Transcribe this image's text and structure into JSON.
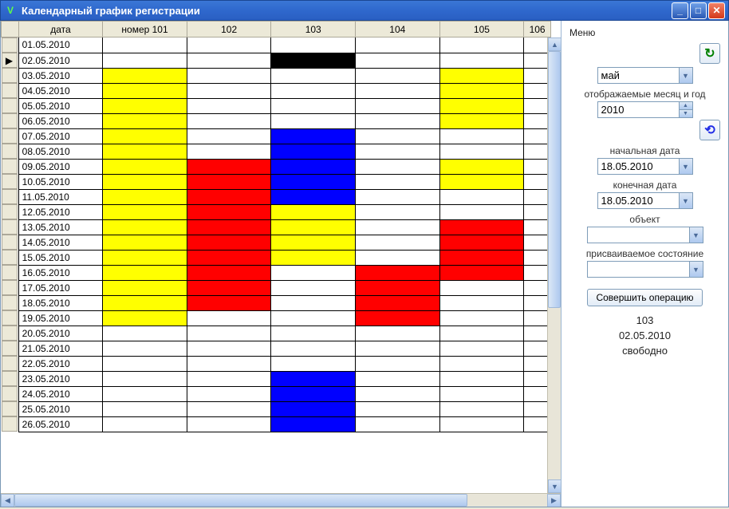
{
  "window": {
    "title": "Календарный график регистрации"
  },
  "menu_label": "Меню",
  "grid": {
    "headers": [
      "",
      "дата",
      "номер 101",
      "102",
      "103",
      "104",
      "105",
      "106"
    ],
    "selected_row_index": 1,
    "rows": [
      {
        "date": "01.05.2010",
        "cells": [
          "",
          "",
          "",
          "",
          "",
          ""
        ]
      },
      {
        "date": "02.05.2010",
        "cells": [
          "",
          "",
          "black",
          "",
          "",
          ""
        ]
      },
      {
        "date": "03.05.2010",
        "cells": [
          "yellow",
          "",
          "",
          "",
          "yellow",
          ""
        ]
      },
      {
        "date": "04.05.2010",
        "cells": [
          "yellow",
          "",
          "",
          "",
          "yellow",
          ""
        ]
      },
      {
        "date": "05.05.2010",
        "cells": [
          "yellow",
          "",
          "",
          "",
          "yellow",
          ""
        ]
      },
      {
        "date": "06.05.2010",
        "cells": [
          "yellow",
          "",
          "",
          "",
          "yellow",
          ""
        ]
      },
      {
        "date": "07.05.2010",
        "cells": [
          "yellow",
          "",
          "blue",
          "",
          "",
          ""
        ]
      },
      {
        "date": "08.05.2010",
        "cells": [
          "yellow",
          "",
          "blue",
          "",
          "",
          ""
        ]
      },
      {
        "date": "09.05.2010",
        "cells": [
          "yellow",
          "red",
          "blue",
          "",
          "yellow",
          ""
        ]
      },
      {
        "date": "10.05.2010",
        "cells": [
          "yellow",
          "red",
          "blue",
          "",
          "yellow",
          ""
        ]
      },
      {
        "date": "11.05.2010",
        "cells": [
          "yellow",
          "red",
          "blue",
          "",
          "",
          ""
        ]
      },
      {
        "date": "12.05.2010",
        "cells": [
          "yellow",
          "red",
          "yellow",
          "",
          "",
          ""
        ]
      },
      {
        "date": "13.05.2010",
        "cells": [
          "yellow",
          "red",
          "yellow",
          "",
          "red",
          ""
        ]
      },
      {
        "date": "14.05.2010",
        "cells": [
          "yellow",
          "red",
          "yellow",
          "",
          "red",
          ""
        ]
      },
      {
        "date": "15.05.2010",
        "cells": [
          "yellow",
          "red",
          "yellow",
          "",
          "red",
          ""
        ]
      },
      {
        "date": "16.05.2010",
        "cells": [
          "yellow",
          "red",
          "",
          "red",
          "red",
          ""
        ]
      },
      {
        "date": "17.05.2010",
        "cells": [
          "yellow",
          "red",
          "",
          "red",
          "",
          ""
        ]
      },
      {
        "date": "18.05.2010",
        "cells": [
          "yellow",
          "red",
          "",
          "red",
          "",
          ""
        ]
      },
      {
        "date": "19.05.2010",
        "cells": [
          "yellow",
          "",
          "",
          "red",
          "",
          ""
        ]
      },
      {
        "date": "20.05.2010",
        "cells": [
          "",
          "",
          "",
          "",
          "",
          ""
        ]
      },
      {
        "date": "21.05.2010",
        "cells": [
          "",
          "",
          "",
          "",
          "",
          ""
        ]
      },
      {
        "date": "22.05.2010",
        "cells": [
          "",
          "",
          "",
          "",
          "",
          ""
        ]
      },
      {
        "date": "23.05.2010",
        "cells": [
          "",
          "",
          "blue",
          "",
          "",
          ""
        ]
      },
      {
        "date": "24.05.2010",
        "cells": [
          "",
          "",
          "blue",
          "",
          "",
          ""
        ]
      },
      {
        "date": "25.05.2010",
        "cells": [
          "",
          "",
          "blue",
          "",
          "",
          ""
        ]
      },
      {
        "date": "26.05.2010",
        "cells": [
          "",
          "",
          "blue",
          "",
          "",
          ""
        ]
      }
    ]
  },
  "side": {
    "month_value": "май",
    "month_label": "отображаемые месяц и год",
    "year_value": "2010",
    "start_label": "начальная дата",
    "start_value": "18.05.2010",
    "end_label": "конечная дата",
    "end_value": "18.05.2010",
    "object_label": "объект",
    "object_value": "",
    "state_label": "присваиваемое состояние",
    "state_value": "",
    "action_button": "Совершить операцию",
    "info_room": "103",
    "info_date": "02.05.2010",
    "info_status": "свободно"
  }
}
